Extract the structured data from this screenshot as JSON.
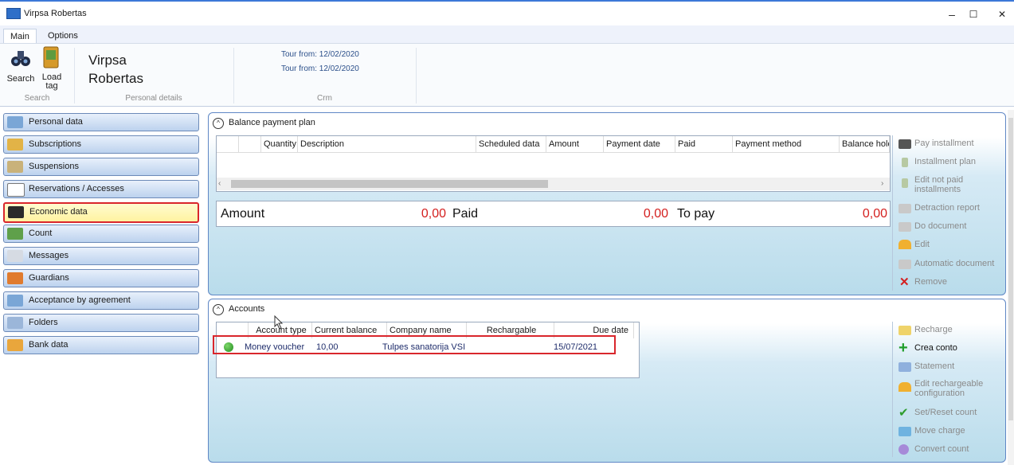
{
  "window": {
    "title": "Virpsa Robertas",
    "controls": {
      "minimize": "–",
      "maximize": "☐",
      "close": "✕"
    }
  },
  "ribbon": {
    "tabs": [
      "Main",
      "Options"
    ],
    "search_label": "Search",
    "load_tag_label": "Load tag",
    "person_first": "Virpsa",
    "person_last": "Robertas",
    "tour_line_1": "Tour from: 12/02/2020",
    "tour_line_2": "Tour from: 12/02/2020",
    "groups": {
      "search": "Search",
      "personal": "Personal details",
      "crm": "Crm"
    }
  },
  "nav": [
    {
      "label": "Personal data",
      "icon": "person-card-icon"
    },
    {
      "label": "Subscriptions",
      "icon": "ticket-icon"
    },
    {
      "label": "Suspensions",
      "icon": "pause-ticket-icon"
    },
    {
      "label": "Reservations / Accesses",
      "icon": "list-icon"
    },
    {
      "label": "Economic data",
      "icon": "wallet-icon"
    },
    {
      "label": "Count",
      "icon": "money-stack-icon"
    },
    {
      "label": "Messages",
      "icon": "message-icon"
    },
    {
      "label": "Guardians",
      "icon": "people-icon"
    },
    {
      "label": "Acceptance by agreement",
      "icon": "contract-icon"
    },
    {
      "label": "Folders",
      "icon": "folder-icon"
    },
    {
      "label": "Bank data",
      "icon": "bank-icon"
    }
  ],
  "balance_panel": {
    "title": "Balance payment plan",
    "columns": [
      "",
      "Quantity",
      "Description",
      "Scheduled data",
      "Amount",
      "Payment date",
      "Paid",
      "Payment method",
      "Balance hold"
    ],
    "amount_label": "Amount",
    "amount_value": "0,00",
    "paid_label": "Paid",
    "paid_value": "0,00",
    "topay_label": "To pay",
    "topay_value": "0,00",
    "actions": [
      "Pay installment",
      "Installment plan",
      "Edit not paid installments",
      "Detraction report",
      "Do document",
      "Edit",
      "Automatic document",
      "Remove"
    ]
  },
  "accounts_panel": {
    "title": "Accounts",
    "columns": [
      "",
      "Account type",
      "Current balance",
      "Company name",
      "Rechargable",
      "Due date"
    ],
    "rows": [
      {
        "type": "Money voucher",
        "balance": "10,00",
        "company": "Tulpes sanatorija VSI",
        "rechargeable": "",
        "due": "15/07/2021"
      }
    ],
    "actions": [
      "Recharge",
      "Crea conto",
      "Statement",
      "Edit rechargeable configuration",
      "Set/Reset count",
      "Move charge",
      "Convert count"
    ]
  },
  "colors": {
    "accent": "#3c78d8",
    "highlight_border": "#d9262c",
    "total_red": "#d4201f"
  }
}
